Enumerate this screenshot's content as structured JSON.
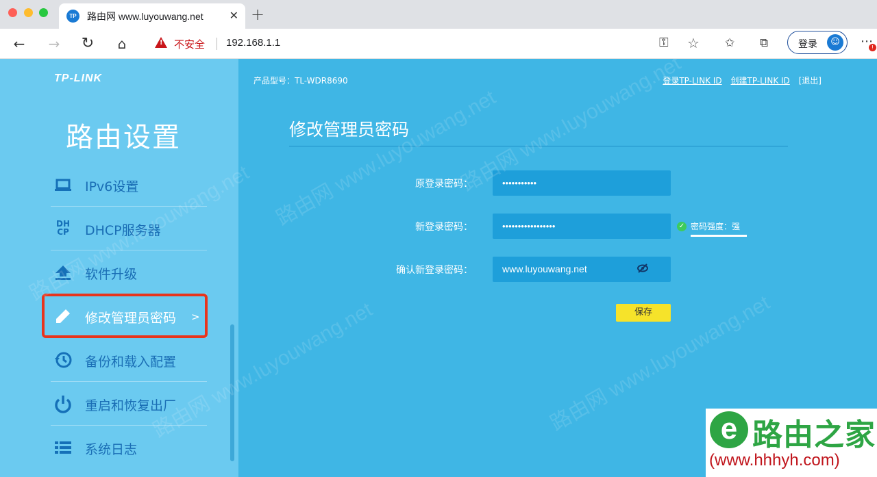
{
  "browser": {
    "tab_title": "路由网 www.luyouwang.net",
    "tab_favicon_text": "TP",
    "tab_close": "✕",
    "new_tab": "+",
    "insecure_label": "不安全",
    "url": "192.168.1.1",
    "login_label": "登录",
    "more_badge": "!"
  },
  "router": {
    "brand": "TP-LINK",
    "sidebar_title": "路由设置",
    "model_label": "产品型号：TL-WDR8690",
    "links": [
      "登录TP-LINK ID",
      "创建TP-LINK ID",
      "[退出]"
    ],
    "menu": [
      {
        "label": "IPv6设置",
        "icon": "laptop-icon"
      },
      {
        "label": "DHCP服务器",
        "icon": "dhcp-icon"
      },
      {
        "label": "软件升级",
        "icon": "upload-icon"
      },
      {
        "label": "修改管理员密码",
        "icon": "pencil-icon",
        "active": true
      },
      {
        "label": "备份和载入配置",
        "icon": "restore-icon"
      },
      {
        "label": "重启和恢复出厂",
        "icon": "power-icon"
      },
      {
        "label": "系统日志",
        "icon": "list-icon"
      }
    ],
    "dhcp_icon_text": "DH\nCP",
    "chevron": ">",
    "section_title": "修改管理员密码",
    "form": {
      "old_label": "原登录密码：",
      "old_value": "•••••••••••",
      "new_label": "新登录密码：",
      "new_value": "•••••••••••••••••",
      "confirm_label": "确认新登录密码：",
      "confirm_value": "www.luyouwang.net",
      "strength_label": "密码强度：强",
      "save_label": "保存"
    }
  },
  "overlay_logo": {
    "name": "路由之家",
    "url": "(www.hhhyh.com)"
  },
  "watermark": "路由网 www.luyouwang.net",
  "colors": {
    "page_bg": "#3fb6e5",
    "sidebar_bg": "#6bcaf0",
    "input_bg": "#1e9fda",
    "save_button": "#f6e32a",
    "highlight_box": "#e8341c"
  }
}
